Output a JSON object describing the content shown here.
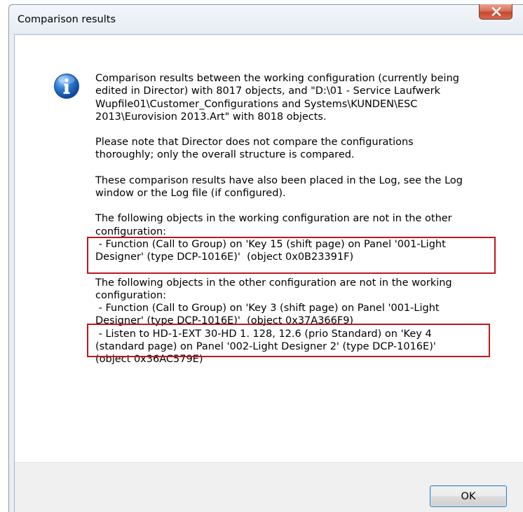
{
  "window": {
    "title": "Comparison results",
    "close_label": "X"
  },
  "icon": {
    "name": "info-icon",
    "glyph": "i"
  },
  "message": {
    "paragraph1": "Comparison results between the working configuration (currently being\nedited in Director) with 8017 objects, and \"D:\\01 - Service Laufwerk\nWupfile01\\Customer_Configurations and Systems\\KUNDEN\\ESC\n2013\\Eurovision 2013.Art\" with 8018 objects.",
    "paragraph2": "Please note that Director does not compare the configurations\nthoroughly; only the overall structure is compared.",
    "paragraph3": "These comparison results have also been placed in the Log, see the Log\nwindow or the Log file (if configured).",
    "section1_heading": "The following objects in the working configuration are not in the other\nconfiguration:",
    "section1_items": " - Function (Call to Group) on 'Key 15 (shift page) on Panel '001-Light\nDesigner' (type DCP-1016E)'  (object 0x0B23391F)",
    "section2_heading": "The following objects in the other configuration are not in the working\nconfiguration:",
    "section2_items": " - Function (Call to Group) on 'Key 3 (shift page) on Panel '001-Light\nDesigner' (type DCP-1016E)'  (object 0x37A366F9)\n - Listen to HD-1-EXT 30-HD 1. 128, 12.6 (prio Standard) on 'Key 4\n(standard page) on Panel '002-Light Designer 2' (type DCP-1016E)'\n(object 0x36AC579E)"
  },
  "buttons": {
    "ok_label": "OK"
  },
  "colors": {
    "highlight_border": "#c0171c",
    "close_button": "#c44a31",
    "ok_button_border": "#3c7fb1"
  }
}
